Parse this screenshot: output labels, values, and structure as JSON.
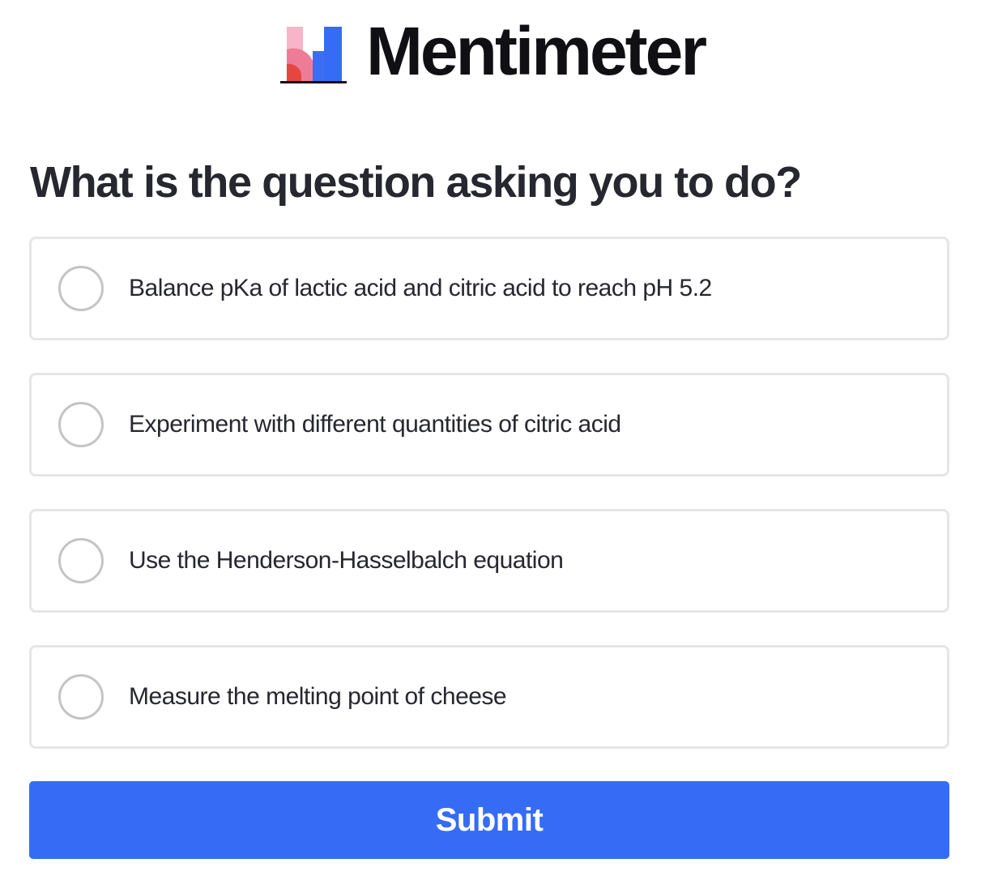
{
  "brand": {
    "name": "Mentimeter",
    "logo_icon": "mentimeter-logo-icon",
    "logo_colors": [
      "#f5a9c0",
      "#ef6b8a",
      "#e5473f",
      "#366cf5",
      "#2c3ea8"
    ]
  },
  "question": {
    "text": "What is the question asking you to do?"
  },
  "options": [
    {
      "label": "Balance pKa of lactic acid and citric acid to reach pH 5.2"
    },
    {
      "label": "Experiment with different quantities of citric acid"
    },
    {
      "label": "Use the Henderson-Hasselbalch equation"
    },
    {
      "label": "Measure the melting point of cheese"
    }
  ],
  "submit": {
    "label": "Submit",
    "color": "#366cf5"
  }
}
